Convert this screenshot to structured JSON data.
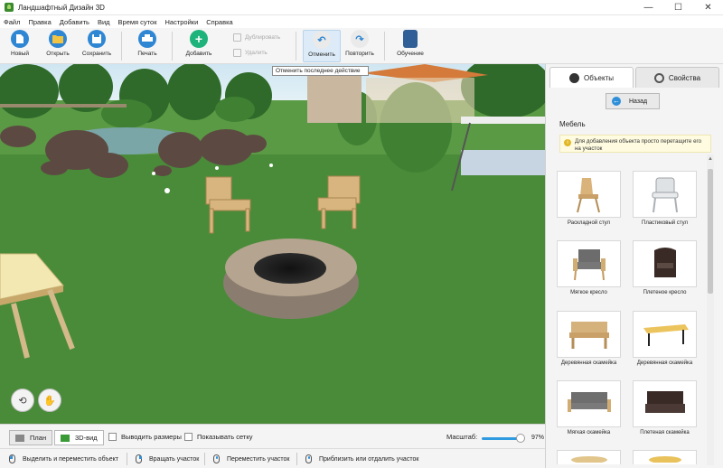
{
  "window": {
    "title": "Ландшафтный Дизайн 3D",
    "controls": [
      "—",
      "☐",
      "✕"
    ]
  },
  "menu": [
    "Файл",
    "Правка",
    "Добавить",
    "Вид",
    "Время суток",
    "Настройки",
    "Справка"
  ],
  "toolbar": {
    "new": "Новый",
    "open": "Открыть",
    "save": "Сохранить",
    "print": "Печать",
    "add": "Добавить",
    "duplicate": "Дублировать",
    "delete": "Удалить",
    "undo": "Отменить",
    "redo": "Повторить",
    "tutorial": "Обучение"
  },
  "tooltip": "Отменить последнее действие",
  "panel": {
    "tab_objects": "Объекты",
    "tab_properties": "Свойства",
    "back": "Назад",
    "section": "Мебель",
    "hint": "Для добавления объекта просто перетащите его на участок",
    "items": [
      {
        "label": "Раскладной стул",
        "icon": "folding-chair-icon"
      },
      {
        "label": "Пластиковый стул",
        "icon": "plastic-chair-icon"
      },
      {
        "label": "Мягкое кресло",
        "icon": "soft-armchair-icon"
      },
      {
        "label": "Плетеное кресло",
        "icon": "wicker-armchair-icon"
      },
      {
        "label": "Деревянная скамейка",
        "icon": "wooden-bench-icon"
      },
      {
        "label": "Деревянная скамейка",
        "icon": "wooden-bench-metal-icon"
      },
      {
        "label": "Мягкая скамейка",
        "icon": "soft-bench-icon"
      },
      {
        "label": "Плетеная скамейка",
        "icon": "wicker-bench-icon"
      }
    ]
  },
  "bottom": {
    "plan": "План",
    "view3d": "3D-вид",
    "show_sizes": "Выводить размеры",
    "show_grid": "Показывать сетку",
    "scale_label": "Масштаб:",
    "scale_value": "97%"
  },
  "status": {
    "select_move": "Выделить и переместить объект",
    "rotate": "Вращать участок",
    "move_area": "Переместить участок",
    "zoom": "Приблизить или отдалить участок"
  },
  "colors": {
    "accent": "#2e9adf",
    "add": "#1db37a",
    "toolbar_blue": "#2f86d3"
  }
}
